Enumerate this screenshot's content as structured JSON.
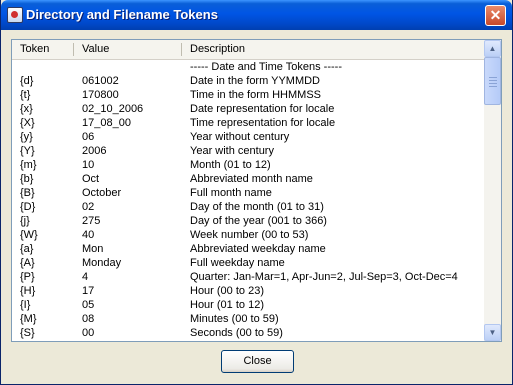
{
  "window": {
    "title": "Directory and Filename Tokens",
    "close_glyph": "✕"
  },
  "columns": {
    "token": "Token",
    "value": "Value",
    "description": "Description"
  },
  "rows": [
    {
      "token": "",
      "value": "",
      "description": "----- Date and Time Tokens -----"
    },
    {
      "token": "{d}",
      "value": "061002",
      "description": "Date in the form YYMMDD"
    },
    {
      "token": "{t}",
      "value": "170800",
      "description": "Time in the form HHMMSS"
    },
    {
      "token": "{x}",
      "value": "02_10_2006",
      "description": "Date representation for locale"
    },
    {
      "token": "{X}",
      "value": "17_08_00",
      "description": "Time representation for locale"
    },
    {
      "token": "{y}",
      "value": "06",
      "description": "Year without century"
    },
    {
      "token": "{Y}",
      "value": "2006",
      "description": "Year with century"
    },
    {
      "token": "{m}",
      "value": "10",
      "description": "Month (01 to 12)"
    },
    {
      "token": "{b}",
      "value": "Oct",
      "description": "Abbreviated month name"
    },
    {
      "token": "{B}",
      "value": "October",
      "description": "Full month name"
    },
    {
      "token": "{D}",
      "value": "02",
      "description": "Day of the month (01 to 31)"
    },
    {
      "token": "{j}",
      "value": "275",
      "description": "Day of the year (001 to 366)"
    },
    {
      "token": "{W}",
      "value": "40",
      "description": "Week number (00 to 53)"
    },
    {
      "token": "{a}",
      "value": "Mon",
      "description": "Abbreviated weekday name"
    },
    {
      "token": "{A}",
      "value": "Monday",
      "description": "Full weekday name"
    },
    {
      "token": "{P}",
      "value": "4",
      "description": "Quarter: Jan-Mar=1, Apr-Jun=2, Jul-Sep=3, Oct-Dec=4"
    },
    {
      "token": "{H}",
      "value": "17",
      "description": "Hour (00 to 23)"
    },
    {
      "token": "{I}",
      "value": "05",
      "description": "Hour (01 to 12)"
    },
    {
      "token": "{M}",
      "value": "08",
      "description": "Minutes (00 to 59)"
    },
    {
      "token": "{S}",
      "value": "00",
      "description": "Seconds (00 to 59)"
    }
  ],
  "scrollbar": {
    "up_glyph": "▲",
    "down_glyph": "▼"
  },
  "buttons": {
    "close_label": "Close"
  },
  "icons": {
    "app": "app-window-icon",
    "close": "close-icon",
    "scroll_up": "chevron-up-icon",
    "scroll_down": "chevron-down-icon"
  }
}
